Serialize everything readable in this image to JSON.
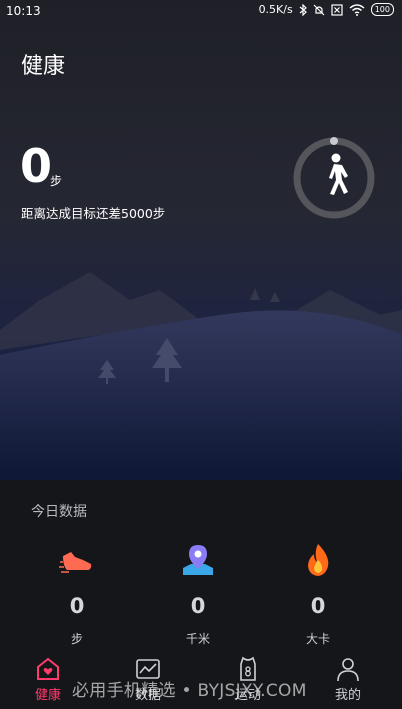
{
  "status_bar": {
    "time": "10:13",
    "network_speed": "0.5K/s",
    "battery": "100",
    "icons": [
      "bluetooth-icon",
      "mute-icon",
      "sim-off-icon",
      "wifi-icon",
      "battery-icon"
    ]
  },
  "page": {
    "title": "健康"
  },
  "steps": {
    "value": "0",
    "unit": "步",
    "goal_text": "距离达成目标还差5000步",
    "progress": 0
  },
  "today": {
    "heading": "今日数据",
    "stats": [
      {
        "icon": "shoe-icon",
        "value": "0",
        "unit": "步"
      },
      {
        "icon": "location-pin-icon",
        "value": "0",
        "unit": "千米"
      },
      {
        "icon": "flame-icon",
        "value": "0",
        "unit": "大卡"
      }
    ]
  },
  "tabs": [
    {
      "icon": "heart-home-icon",
      "label": "健康",
      "active": true
    },
    {
      "icon": "chart-icon",
      "label": "数据",
      "active": false
    },
    {
      "icon": "jersey-icon",
      "label": "运动",
      "active": false
    },
    {
      "icon": "person-icon",
      "label": "我的",
      "active": false
    }
  ],
  "watermark": "必用手机精选 • BYJSJXY.COM",
  "colors": {
    "accent": "#ff3b6b",
    "pin": "#8a7cf5",
    "flame": "#ff6a1a",
    "shoe": "#ff6b52"
  }
}
